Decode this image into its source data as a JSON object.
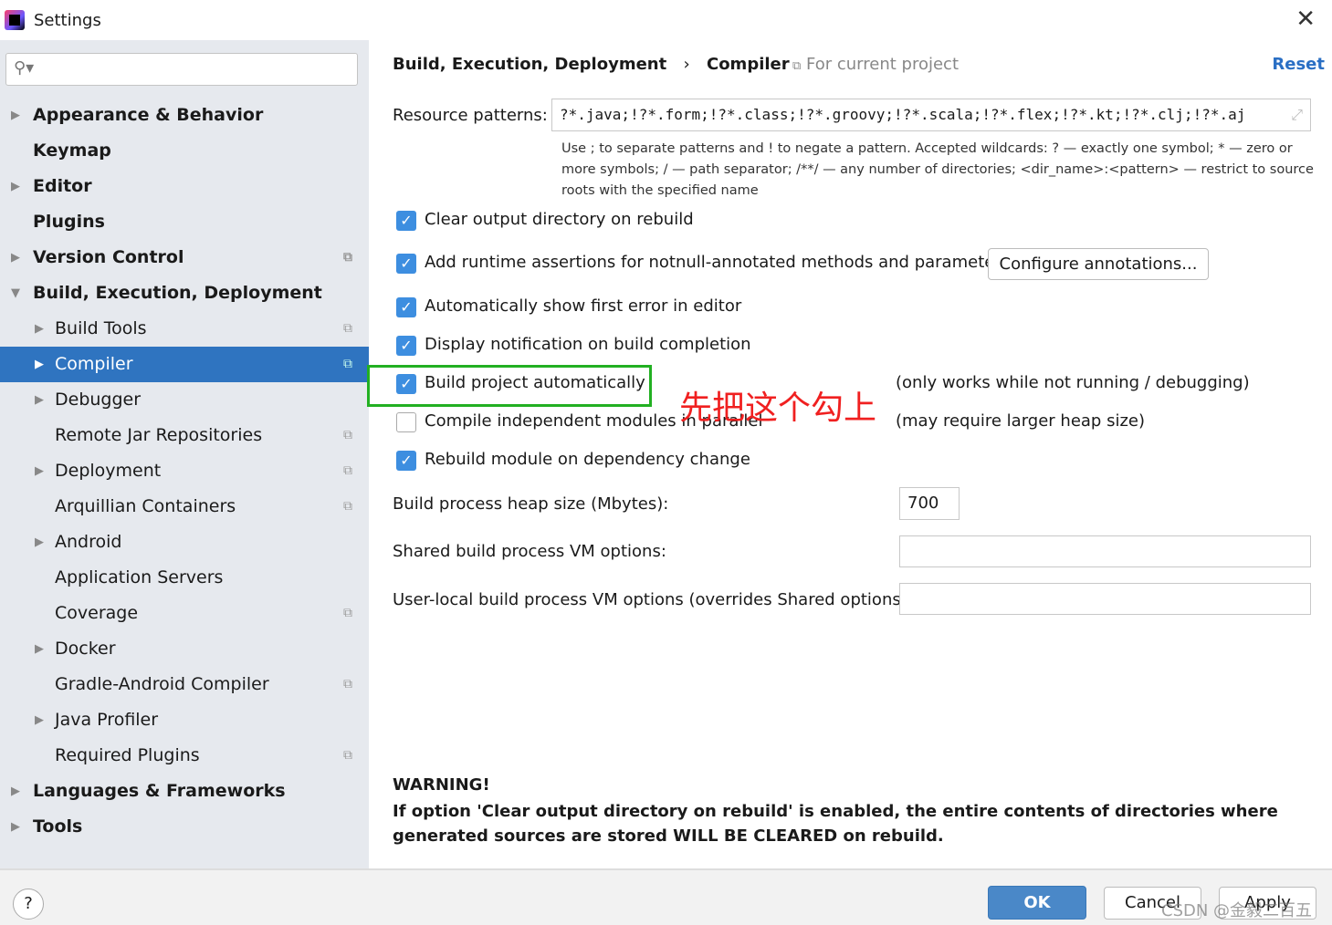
{
  "window": {
    "title": "Settings",
    "close_icon": "close-icon"
  },
  "sidebar": {
    "search_placeholder": "",
    "items": [
      {
        "label": "Appearance & Behavior",
        "level": 0,
        "arrow": "right",
        "bold": true
      },
      {
        "label": "Keymap",
        "level": 0,
        "bold": true
      },
      {
        "label": "Editor",
        "level": 0,
        "arrow": "right",
        "bold": true
      },
      {
        "label": "Plugins",
        "level": 0,
        "bold": true
      },
      {
        "label": "Version Control",
        "level": 0,
        "arrow": "right",
        "bold": true,
        "copy": true
      },
      {
        "label": "Build, Execution, Deployment",
        "level": 0,
        "arrow": "down",
        "bold": true
      },
      {
        "label": "Build Tools",
        "level": 1,
        "arrow": "right",
        "copy": true
      },
      {
        "label": "Compiler",
        "level": 1,
        "arrow": "right",
        "copy": true,
        "selected": true
      },
      {
        "label": "Debugger",
        "level": 1,
        "arrow": "right"
      },
      {
        "label": "Remote Jar Repositories",
        "level": 1,
        "copy": true
      },
      {
        "label": "Deployment",
        "level": 1,
        "arrow": "right",
        "copy": true
      },
      {
        "label": "Arquillian Containers",
        "level": 1,
        "copy": true
      },
      {
        "label": "Android",
        "level": 1,
        "arrow": "right"
      },
      {
        "label": "Application Servers",
        "level": 1
      },
      {
        "label": "Coverage",
        "level": 1,
        "copy": true
      },
      {
        "label": "Docker",
        "level": 1,
        "arrow": "right"
      },
      {
        "label": "Gradle-Android Compiler",
        "level": 1,
        "copy": true
      },
      {
        "label": "Java Profiler",
        "level": 1,
        "arrow": "right"
      },
      {
        "label": "Required Plugins",
        "level": 1,
        "copy": true
      },
      {
        "label": "Languages & Frameworks",
        "level": 0,
        "arrow": "right",
        "bold": true
      },
      {
        "label": "Tools",
        "level": 0,
        "arrow": "right",
        "bold": true
      }
    ]
  },
  "main": {
    "breadcrumb": [
      "Build, Execution, Deployment",
      "Compiler"
    ],
    "scope": "For current project",
    "reset": "Reset",
    "resource_label": "Resource patterns:",
    "resource_value": "?*.java;!?*.form;!?*.class;!?*.groovy;!?*.scala;!?*.flex;!?*.kt;!?*.clj;!?*.aj",
    "resource_help": "Use ; to separate patterns and ! to negate a pattern. Accepted wildcards: ? — exactly one symbol; * — zero or more symbols; / — path separator; /**/ — any number of directories; <dir_name>:<pattern> — restrict to source roots with the specified name",
    "options": [
      {
        "label": "Clear output directory on rebuild",
        "checked": true
      },
      {
        "label": "Add runtime assertions for notnull-annotated methods and parameters",
        "checked": true
      },
      {
        "label": "Automatically show first error in editor",
        "checked": true
      },
      {
        "label": "Display notification on build completion",
        "checked": true
      },
      {
        "label": "Build project automatically",
        "checked": true,
        "note": "(only works while not running / debugging)"
      },
      {
        "label": "Compile independent modules in parallel",
        "checked": false,
        "note": "(may require larger heap size)"
      },
      {
        "label": "Rebuild module on dependency change",
        "checked": true
      }
    ],
    "configure_button": "Configure annotations...",
    "annotation_text": "先把这个勾上",
    "highlight_color": "#22b022",
    "heap_label": "Build process heap size (Mbytes):",
    "heap_value": "700",
    "shared_label": "Shared build process VM options:",
    "shared_value": "",
    "user_label": "User-local build process VM options (overrides Shared options):",
    "user_value": "",
    "warning_title": "WARNING!",
    "warning_text": "If option 'Clear output directory on rebuild' is enabled, the entire contents of directories where generated sources are stored WILL BE CLEARED on rebuild."
  },
  "footer": {
    "help": "?",
    "ok": "OK",
    "cancel": "Cancel",
    "apply": "Apply",
    "watermark": "CSDN @金毅二百五"
  }
}
